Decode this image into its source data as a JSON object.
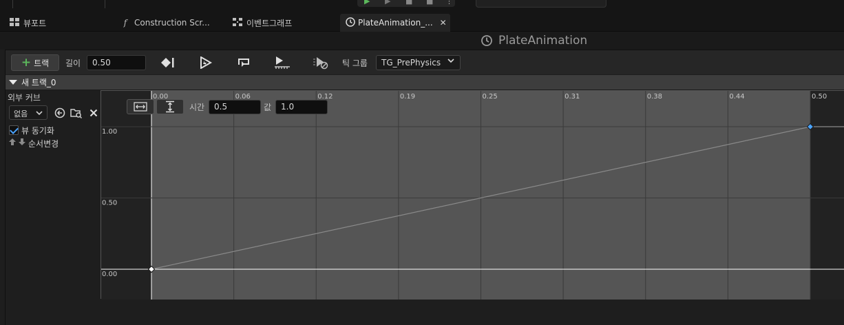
{
  "tabs": [
    {
      "icon": "viewport-icon",
      "label": "뷰포트"
    },
    {
      "icon": "function-icon",
      "label": "Construction Scr..."
    },
    {
      "icon": "event-graph-icon",
      "label": "이벤트그래프"
    },
    {
      "icon": "clock-icon",
      "label": "PlateAnimation_...",
      "active": true
    }
  ],
  "title": "PlateAnimation",
  "toolbar": {
    "add_track_label": "트랙",
    "length_label": "길이",
    "length_value": "0.50",
    "tick_group_label": "틱 그룹",
    "tick_group_value": "TG_PrePhysics"
  },
  "track": {
    "name": "새 트랙_0",
    "external_curve_label": "외부 커브",
    "external_curve_value": "없음",
    "sync_view_label": "뷰 동기화",
    "sync_view_checked": true,
    "reorder_label": "순서변경"
  },
  "curve_editor": {
    "time_label": "시간",
    "time_value": "0.5",
    "value_label": "값",
    "value_value": "1.0",
    "x_ticks": [
      "0.00",
      "0.06",
      "0.12",
      "0.19",
      "0.25",
      "0.31",
      "0.38",
      "0.44",
      "0.50"
    ],
    "y_ticks": [
      "1.00",
      "0.50",
      "0.00"
    ]
  },
  "chart_data": {
    "type": "line",
    "x": [
      0.0,
      0.5
    ],
    "series": [
      {
        "values": [
          0.0,
          1.0
        ]
      }
    ],
    "xlim": [
      0,
      0.5
    ],
    "ylim": [
      0,
      1
    ]
  },
  "colors": {
    "curve": "#8a8a8a",
    "key_selected": "#4aa3ff",
    "key": "#ffffff",
    "accent_green": "#5cb85c"
  }
}
